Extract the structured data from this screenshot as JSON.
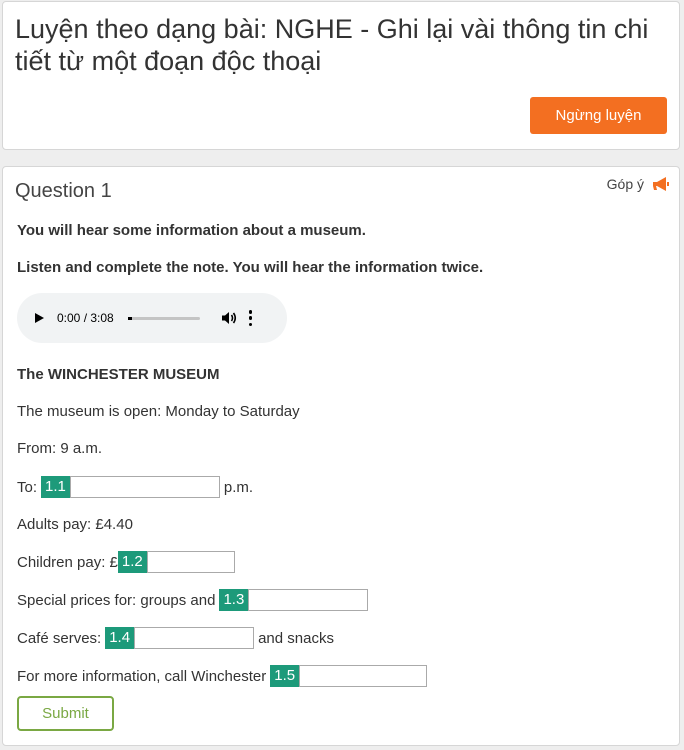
{
  "header": {
    "title": "Luyện theo dạng bài: NGHE - Ghi lại vài thông tin chi tiết từ một đoạn độc thoại",
    "stop_label": "Ngừng luyện"
  },
  "question": {
    "title": "Question 1",
    "feedback_label": "Góp ý",
    "instruction_1": "You will hear some information about a museum.",
    "instruction_2": "Listen and complete the note. You will hear the information twice.",
    "audio": {
      "time": "0:00 / 3:08",
      "progress": 0
    },
    "note_title": "The WINCHESTER MUSEUM",
    "open_line": "The museum is open: Monday to Saturday",
    "from_line": "From: 9 a.m.",
    "to_prefix": "To:",
    "to_suffix": "p.m.",
    "adults_line": "Adults pay: £4.40",
    "children_prefix": "Children pay: £",
    "special_prefix": "Special prices for: groups and",
    "cafe_prefix": "Café serves:",
    "cafe_suffix": "and snacks",
    "info_prefix": "For more information, call Winchester",
    "blanks": [
      {
        "label": "1.1",
        "value": ""
      },
      {
        "label": "1.2",
        "value": ""
      },
      {
        "label": "1.3",
        "value": ""
      },
      {
        "label": "1.4",
        "value": ""
      },
      {
        "label": "1.5",
        "value": ""
      }
    ],
    "submit_label": "Submit"
  },
  "colors": {
    "accent_orange": "#f36f21",
    "blank_green": "#1d9a7a",
    "submit_green": "#7aa843"
  },
  "icons": {
    "feedback": "megaphone-icon",
    "play": "play-icon",
    "volume": "volume-icon",
    "more": "more-vertical-icon"
  }
}
